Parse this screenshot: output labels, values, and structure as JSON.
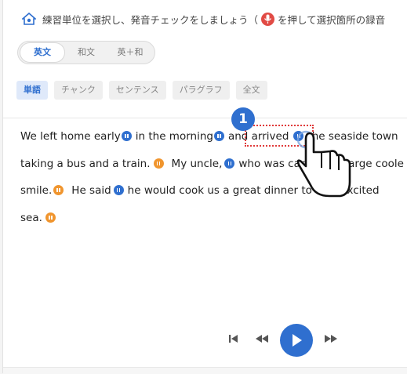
{
  "instruction": {
    "part1": "練習単位を選択し、発音チェックをしましょう（",
    "part2": "を押して選択箇所の録音"
  },
  "language_toggle": [
    {
      "label": "英文",
      "active": true
    },
    {
      "label": "和文",
      "active": false
    },
    {
      "label": "英＋和",
      "active": false
    }
  ],
  "unit_chips": [
    {
      "label": "単語",
      "active": true
    },
    {
      "label": "チャンク",
      "active": false
    },
    {
      "label": "センテンス",
      "active": false
    },
    {
      "label": "パラグラフ",
      "active": false
    },
    {
      "label": "全文",
      "active": false
    }
  ],
  "passage": {
    "l1_a": "We left home early",
    "l1_b": "in the morning",
    "l1_c": "and arrived",
    "l1_d": "the seaside town",
    "l2_a": "taking a bus and a train.",
    "l2_b": "My uncle,",
    "l2_c": "who was car",
    "l2_d": "large coole",
    "l3_a": "smile.",
    "l3_b": "He said",
    "l3_c": "he would cook us a great dinner to",
    "l3_d": "Excited",
    "l4_a": "sea."
  },
  "step_marker": "1",
  "colors": {
    "accent_blue": "#2f6fcf",
    "marker_orange": "#f0952e",
    "selection_red": "#e03a3a"
  }
}
